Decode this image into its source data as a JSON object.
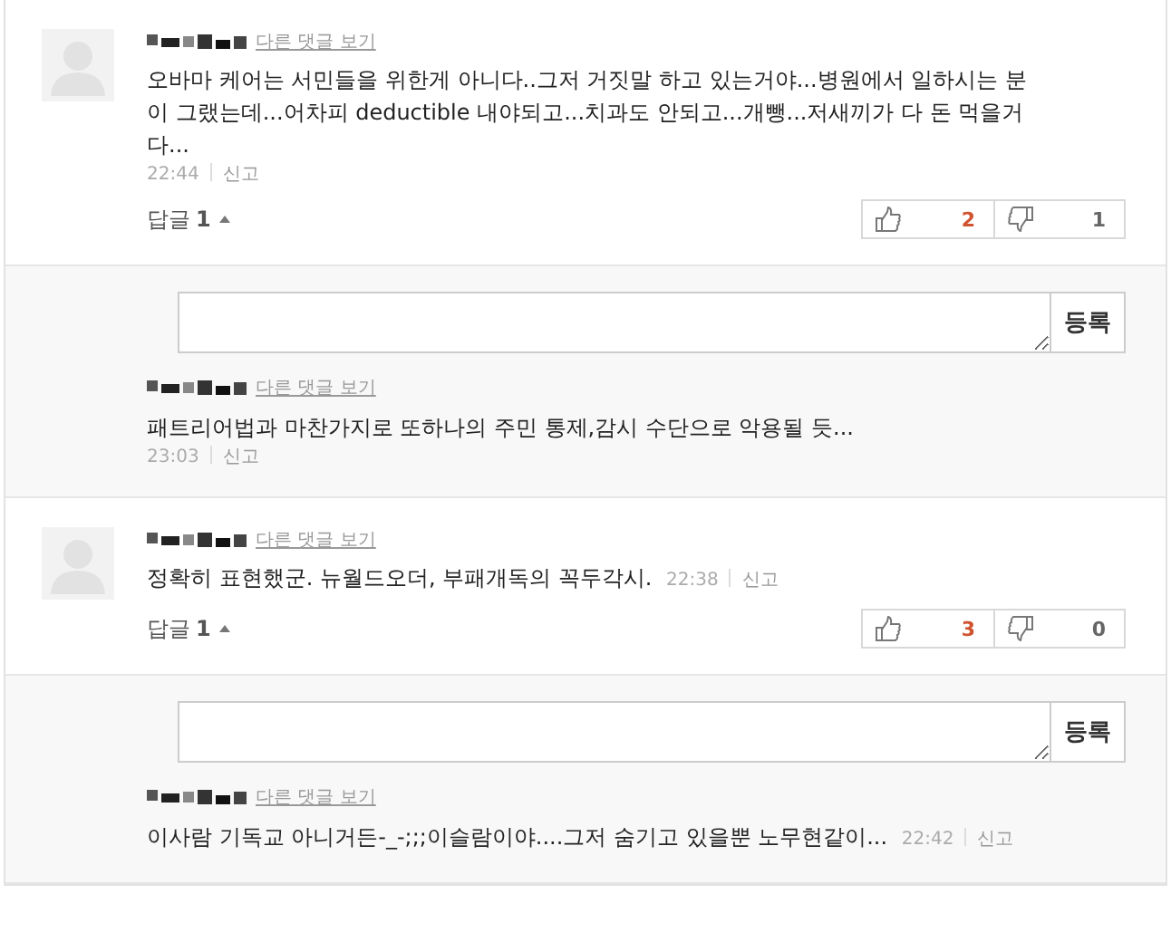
{
  "comments": [
    {
      "kind": "stacked",
      "more_link": "다른 댓글 보기",
      "text": "오바마 케어는 서민들을 위한게 아니다..그저 거짓말 하고 있는거야...병원에서 일하시는 분이 그랬는데...어차피 deductible 내야되고...치과도 안되고...개뺑...저새끼가 다 돈 먹을거다...",
      "time": "22:44",
      "report": "신고",
      "reply_label": "답글",
      "reply_count": "1",
      "replies_expanded": true,
      "likes": "2",
      "dislikes": "1",
      "reply_button": "등록",
      "replies": [
        {
          "kind": "stacked",
          "more_link": "다른 댓글 보기",
          "text": "패트리어법과 마찬가지로 또하나의 주민 통제,감시 수단으로 악용될 듯...",
          "time": "23:03",
          "report": "신고"
        }
      ]
    },
    {
      "kind": "inline",
      "more_link": "다른 댓글 보기",
      "text": "정확히 표현했군. 뉴월드오더, 부패개독의 꼭두각시.",
      "time": "22:38",
      "report": "신고",
      "reply_label": "답글",
      "reply_count": "1",
      "replies_expanded": true,
      "likes": "3",
      "dislikes": "0",
      "reply_button": "등록",
      "replies": [
        {
          "kind": "inline",
          "more_link": "다른 댓글 보기",
          "text": "이사람 기독교 아니거든-_-;;;이슬람이야....그저 숨기고 있을뿐 노무현같이...",
          "time": "22:42",
          "report": "신고"
        }
      ]
    }
  ]
}
